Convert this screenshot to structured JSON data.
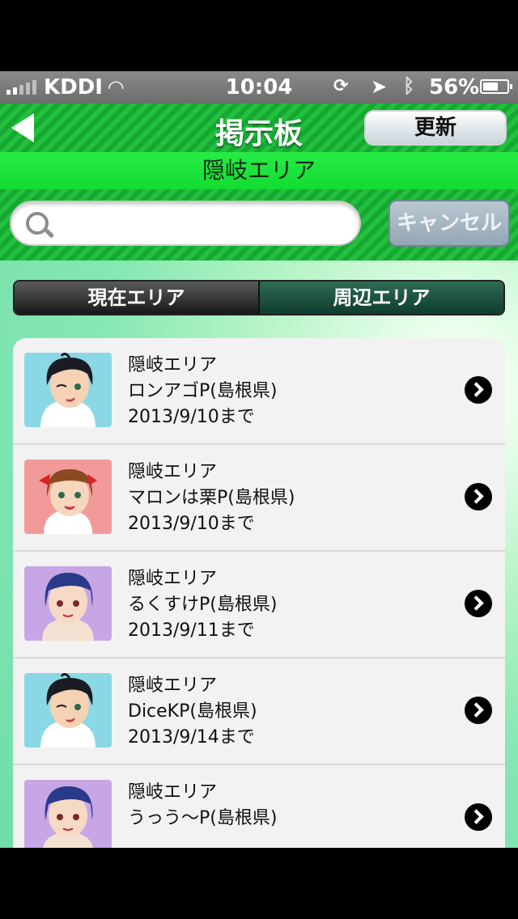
{
  "status_bar": {
    "carrier": "KDDI",
    "time": "10:04",
    "battery_percent": "56%",
    "battery_level": 0.56,
    "icons": [
      "signal-icon",
      "wifi-icon",
      "rotation-lock-icon",
      "location-icon",
      "bluetooth-icon",
      "battery-icon"
    ]
  },
  "navbar": {
    "title": "掲示板",
    "refresh_label": "更新",
    "back_icon": "back-arrow-icon"
  },
  "area_title": "隠岐エリア",
  "search": {
    "placeholder": "",
    "value": "",
    "cancel_label": "キャンセル"
  },
  "segments": [
    {
      "label": "現在エリア",
      "selected": false
    },
    {
      "label": "周辺エリア",
      "selected": true
    }
  ],
  "list": [
    {
      "area": "隠岐エリア",
      "name": "ロンアゴP(島根県)",
      "date": "2013/9/10まで",
      "avatar": "wink-girl",
      "bg": "#8ad8e6"
    },
    {
      "area": "隠岐エリア",
      "name": "マロンは栗P(島根県)",
      "date": "2013/9/10まで",
      "avatar": "ribbon-girl",
      "bg": "#f29a9a"
    },
    {
      "area": "隠岐エリア",
      "name": "るくすけP(島根県)",
      "date": "2013/9/11まで",
      "avatar": "blue-hair-girl",
      "bg": "#c7a6e6"
    },
    {
      "area": "隠岐エリア",
      "name": "DiceKP(島根県)",
      "date": "2013/9/14まで",
      "avatar": "wink-girl",
      "bg": "#8ad8e6"
    },
    {
      "area": "隠岐エリア",
      "name": "うっう～P(島根県)",
      "date": "",
      "avatar": "blue-hair-girl",
      "bg": "#c7a6e6"
    }
  ]
}
